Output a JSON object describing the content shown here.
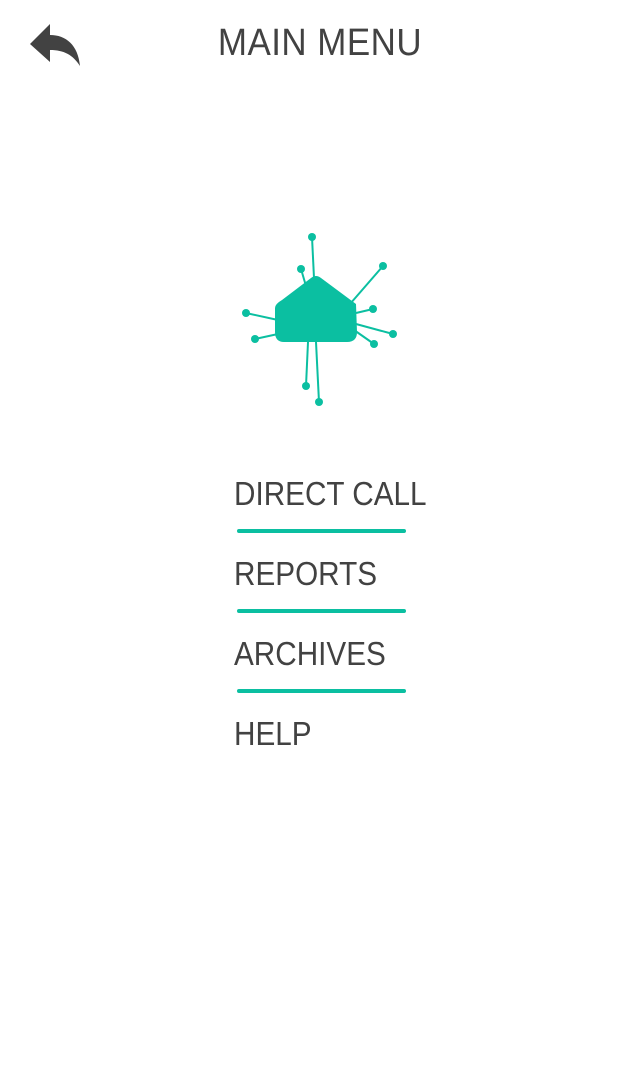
{
  "header": {
    "title": "MAIN MENU",
    "back_icon": "reply-arrow-icon"
  },
  "logo": {
    "icon": "house-network-icon",
    "color": "#0bbfa1"
  },
  "menu": {
    "items": [
      {
        "label": "DIRECT CALL",
        "name": "direct-call"
      },
      {
        "label": "REPORTS",
        "name": "reports"
      },
      {
        "label": "ARCHIVES",
        "name": "archives"
      },
      {
        "label": "HELP",
        "name": "help"
      }
    ],
    "divider_color": "#0bbfa1"
  },
  "colors": {
    "text": "#424242",
    "accent": "#0bbfa1",
    "background": "#ffffff"
  }
}
